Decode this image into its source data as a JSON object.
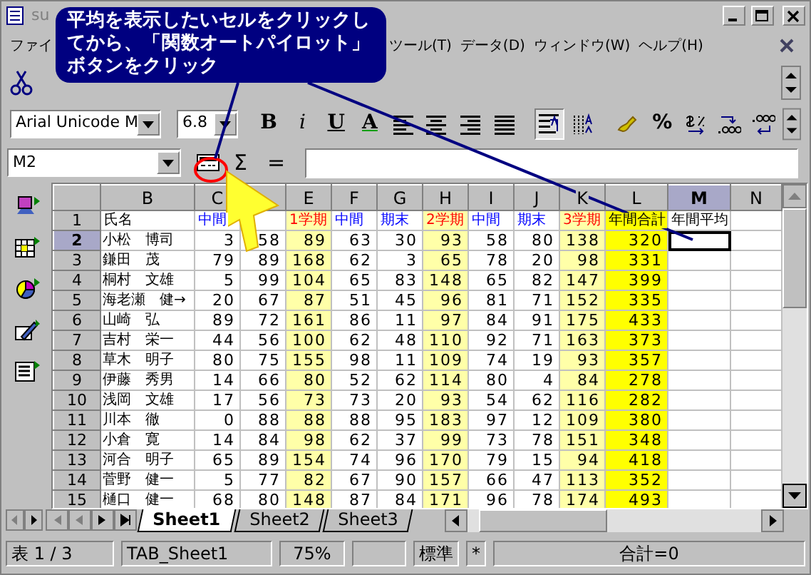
{
  "window": {
    "title": "su"
  },
  "callout": {
    "text": "平均を表示したいセルをクリックしてから、「関数オートパイロット」ボタンをクリック"
  },
  "menu": [
    "ファイ",
    "ツール(T)",
    "データ(D)",
    "ウィンドウ(W)",
    "ヘルプ(H)"
  ],
  "format_toolbar": {
    "font": "Arial Unicode M",
    "size": "6.8",
    "buttons": [
      {
        "kind": "letter",
        "label": "B",
        "pressed": false
      },
      {
        "kind": "letter",
        "label": "i",
        "pressed": false
      },
      {
        "kind": "letter",
        "label": "U",
        "pressed": false
      },
      {
        "kind": "font-color",
        "label": "A",
        "pressed": false
      },
      {
        "kind": "align-left",
        "pressed": false
      },
      {
        "kind": "align-center",
        "pressed": false
      },
      {
        "kind": "align-right",
        "pressed": false
      },
      {
        "kind": "justify",
        "pressed": false
      },
      {
        "kind": "wrap",
        "pressed": true
      },
      {
        "kind": "distribute",
        "pressed": false
      },
      {
        "kind": "brush",
        "pressed": false
      },
      {
        "kind": "letter",
        "label": "%",
        "pressed": false
      },
      {
        "kind": "currency",
        "pressed": false
      },
      {
        "kind": "decimal-add",
        "pressed": false
      },
      {
        "kind": "decimal-remove",
        "pressed": false
      }
    ]
  },
  "formula_bar": {
    "name_box": "M2",
    "sum_symbol": "Σ",
    "equals_symbol": "="
  },
  "sheet": {
    "columns": [
      {
        "label": "B",
        "selected": false
      },
      {
        "label": "C",
        "selected": false
      },
      {
        "selected": false
      },
      {
        "label": "E",
        "selected": false,
        "color": "#ffffa8"
      },
      {
        "label": "F",
        "selected": false
      },
      {
        "label": "G",
        "selected": false
      },
      {
        "label": "H",
        "selected": false,
        "color": "#ffffa8"
      },
      {
        "label": "I",
        "selected": false
      },
      {
        "label": "J",
        "selected": false
      },
      {
        "label": "K",
        "selected": false,
        "color": "#ffffa8"
      },
      {
        "label": "L",
        "selected": false,
        "color": "#ffff00"
      },
      {
        "label": "M",
        "selected": true
      },
      {
        "label": "N",
        "selected": false
      }
    ],
    "rows": [
      {
        "number": "1",
        "selected": false,
        "cells": [
          {
            "text": "氏名"
          },
          {
            "text": "中間",
            "color": "#0000ff"
          },
          null,
          {
            "text": "1学期",
            "color": "#ff0000"
          },
          {
            "text": "中間",
            "color": "#0000ff"
          },
          {
            "text": "期末",
            "color": "#0000ff"
          },
          {
            "text": "2学期",
            "color": "#ff0000"
          },
          {
            "text": "中間",
            "color": "#0000ff"
          },
          {
            "text": "期末",
            "color": "#0000ff"
          },
          {
            "text": "3学期",
            "color": "#ff0000"
          },
          {
            "text": "年間合計"
          },
          {
            "text": "年間平均"
          }
        ]
      },
      {
        "number": "2",
        "selected": true,
        "cells": [
          "小松　博司",
          "3",
          "58",
          "89",
          "63",
          "30",
          "93",
          "58",
          "80",
          "138",
          "320"
        ]
      },
      {
        "number": "3",
        "selected": false,
        "cells": [
          "鎌田　茂",
          "79",
          "89",
          "168",
          "62",
          "3",
          "65",
          "78",
          "20",
          "98",
          "331"
        ]
      },
      {
        "number": "4",
        "selected": false,
        "cells": [
          "桐村　文雄",
          "5",
          "99",
          "104",
          "65",
          "83",
          "148",
          "65",
          "82",
          "147",
          "399"
        ]
      },
      {
        "number": "5",
        "selected": false,
        "cells": [
          "海老瀬　健→",
          "20",
          "67",
          "87",
          "51",
          "45",
          "96",
          "81",
          "71",
          "152",
          "335"
        ]
      },
      {
        "number": "6",
        "selected": false,
        "cells": [
          "山崎　弘",
          "89",
          "72",
          "161",
          "86",
          "11",
          "97",
          "84",
          "91",
          "175",
          "433"
        ]
      },
      {
        "number": "7",
        "selected": false,
        "cells": [
          "吉村　栄一",
          "44",
          "56",
          "100",
          "62",
          "48",
          "110",
          "92",
          "71",
          "163",
          "373"
        ]
      },
      {
        "number": "8",
        "selected": false,
        "cells": [
          "草木　明子",
          "80",
          "75",
          "155",
          "98",
          "11",
          "109",
          "74",
          "19",
          "93",
          "357"
        ]
      },
      {
        "number": "9",
        "selected": false,
        "cells": [
          "伊藤　秀男",
          "14",
          "66",
          "80",
          "52",
          "62",
          "114",
          "80",
          "4",
          "84",
          "278"
        ]
      },
      {
        "number": "10",
        "selected": false,
        "cells": [
          "浅岡　文雄",
          "17",
          "56",
          "73",
          "73",
          "20",
          "93",
          "54",
          "62",
          "116",
          "282"
        ]
      },
      {
        "number": "11",
        "selected": false,
        "cells": [
          "川本　徹",
          "0",
          "88",
          "88",
          "88",
          "95",
          "183",
          "97",
          "12",
          "109",
          "380"
        ]
      },
      {
        "number": "12",
        "selected": false,
        "cells": [
          "小倉　寛",
          "14",
          "84",
          "98",
          "62",
          "37",
          "99",
          "73",
          "78",
          "151",
          "348"
        ]
      },
      {
        "number": "13",
        "selected": false,
        "cells": [
          "河合　明子",
          "65",
          "89",
          "154",
          "74",
          "96",
          "170",
          "79",
          "15",
          "94",
          "418"
        ]
      },
      {
        "number": "14",
        "selected": false,
        "cells": [
          "菅野　健一",
          "5",
          "77",
          "82",
          "67",
          "90",
          "157",
          "66",
          "47",
          "113",
          "352"
        ]
      },
      {
        "number": "15",
        "selected": false,
        "cells": [
          "樋口　健一",
          "68",
          "80",
          "148",
          "87",
          "84",
          "171",
          "96",
          "78",
          "174",
          "493"
        ]
      }
    ]
  },
  "sheet_tabs": [
    {
      "label": "Sheet1",
      "selected": true
    },
    {
      "label": "Sheet2",
      "selected": false
    },
    {
      "label": "Sheet3",
      "selected": false
    }
  ],
  "status_bar": [
    "表 1 / 3",
    "TAB_Sheet1",
    "75%",
    "標準",
    "*",
    "合計=0"
  ]
}
